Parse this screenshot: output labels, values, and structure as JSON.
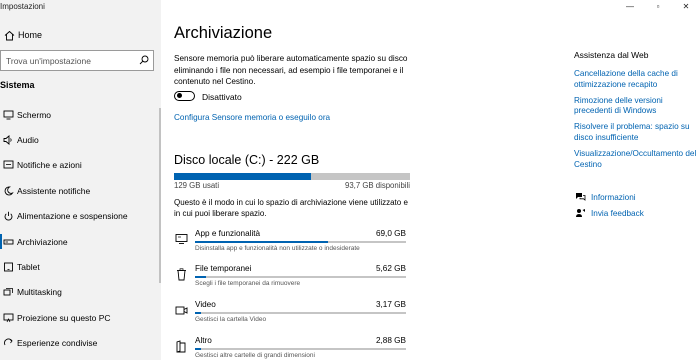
{
  "window": {
    "title": "Impostazioni"
  },
  "sidebar": {
    "home_label": "Home",
    "search_placeholder": "Trova un'impostazione",
    "section_title": "Sistema",
    "items": [
      {
        "label": "Schermo",
        "icon": "display-icon"
      },
      {
        "label": "Audio",
        "icon": "speaker-icon"
      },
      {
        "label": "Notifiche e azioni",
        "icon": "notification-icon"
      },
      {
        "label": "Assistente notifiche",
        "icon": "moon-icon"
      },
      {
        "label": "Alimentazione e sospensione",
        "icon": "power-icon"
      },
      {
        "label": "Archiviazione",
        "icon": "storage-icon"
      },
      {
        "label": "Tablet",
        "icon": "tablet-icon"
      },
      {
        "label": "Multitasking",
        "icon": "multitasking-icon"
      },
      {
        "label": "Proiezione su questo PC",
        "icon": "projection-icon"
      },
      {
        "label": "Esperienze condivise",
        "icon": "shared-icon"
      }
    ]
  },
  "main": {
    "title": "Archiviazione",
    "description": "Sensore memoria può liberare automaticamente spazio su disco eliminando i file non necessari, ad esempio i file temporanei e il contenuto nel Cestino.",
    "toggle_label": "Disattivato",
    "toggle_on": false,
    "configure_link": "Configura Sensore memoria o eseguilo ora",
    "disk": {
      "title": "Disco locale (C:) - 222 GB",
      "used_label": "129 GB usati",
      "free_label": "93,7 GB disponibili",
      "used_fraction": 0.58,
      "description": "Questo è il modo in cui lo spazio di archiviazione viene utilizzato e in cui puoi liberare spazio."
    },
    "categories": [
      {
        "name": "App e funzionalità",
        "size": "69,0 GB",
        "desc": "Disinstalla app e funzionalità non utilizzate o indesiderate",
        "fraction": 0.63,
        "icon": "apps-icon"
      },
      {
        "name": "File temporanei",
        "size": "5,62 GB",
        "desc": "Scegli i file temporanei da rimuovere",
        "fraction": 0.05,
        "icon": "trash-icon"
      },
      {
        "name": "Video",
        "size": "3,17 GB",
        "desc": "Gestisci la cartella Video",
        "fraction": 0.03,
        "icon": "video-icon"
      },
      {
        "name": "Altro",
        "size": "2,88 GB",
        "desc": "Gestisci altre cartelle di grandi dimensioni",
        "fraction": 0.03,
        "icon": "folder-icon"
      }
    ]
  },
  "related": {
    "title": "Assistenza dal Web",
    "links": [
      "Cancellazione della cache di ottimizzazione recapito",
      "Rimozione delle versioni precedenti di Windows",
      "Risolvere il problema: spazio su disco insufficiente",
      "Visualizzazione/Occultamento del Cestino"
    ],
    "info_label": "Informazioni",
    "feedback_label": "Invia feedback"
  },
  "colors": {
    "accent": "#0063b1",
    "sidebar_bg": "#f2f2f2",
    "bar_bg": "#c5c5c5"
  }
}
